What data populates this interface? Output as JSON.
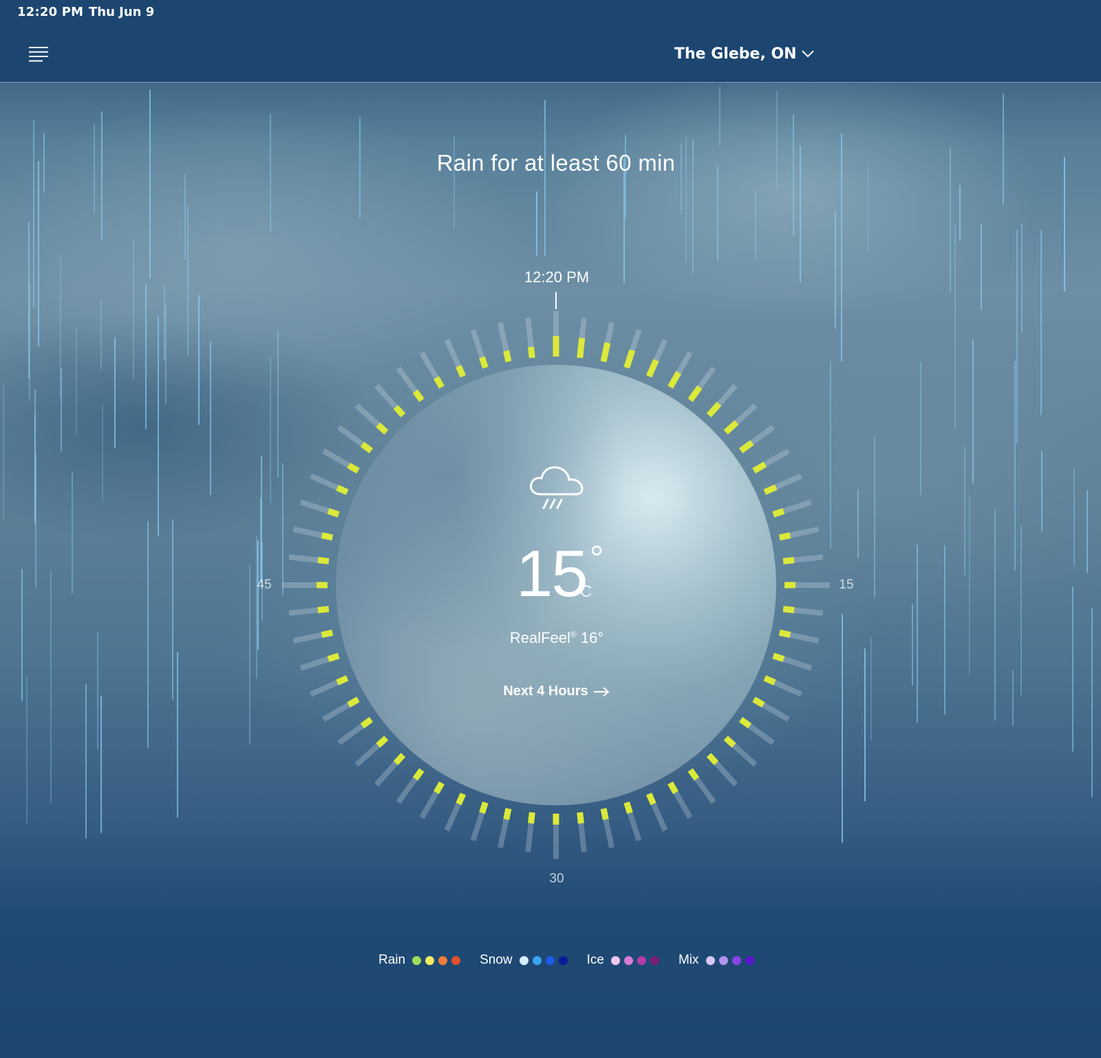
{
  "status_bar": {
    "time": "12:20 PM",
    "date": "Thu Jun 9"
  },
  "header": {
    "menu_icon": "hamburger-menu-icon",
    "location": "The Glebe, ON",
    "location_icon": "chevron-down-icon"
  },
  "headline": "Rain for at least 60 min",
  "dial": {
    "current_time": "12:20 PM",
    "axis_labels": {
      "right": "15",
      "bottom": "30",
      "left": "45"
    },
    "tick_count": 60,
    "precip_ticks_filled": 60,
    "precip_color": "#dbe93a",
    "track_color": "rgba(215,225,235,0.28)"
  },
  "current": {
    "icon": "rain-cloud-icon",
    "temperature": "15",
    "degree_symbol": "°",
    "unit": "C",
    "realfeel_label": "RealFeel",
    "realfeel_mark": "®",
    "realfeel_value": "16°",
    "next_hours": "Next 4 Hours"
  },
  "legend": [
    {
      "label": "Rain",
      "colors": [
        "#9fdc57",
        "#f1ec64",
        "#ef7e3a",
        "#e2512e"
      ]
    },
    {
      "label": "Snow",
      "colors": [
        "#d6ecff",
        "#3ea3f5",
        "#1f5be6",
        "#0a1c9a"
      ]
    },
    {
      "label": "Ice",
      "colors": [
        "#f3c6ee",
        "#d97ad4",
        "#b43aa9",
        "#7a1f74"
      ]
    },
    {
      "label": "Mix",
      "colors": [
        "#d8c8f5",
        "#b294ef",
        "#8a45e3",
        "#5a18c9"
      ]
    }
  ]
}
